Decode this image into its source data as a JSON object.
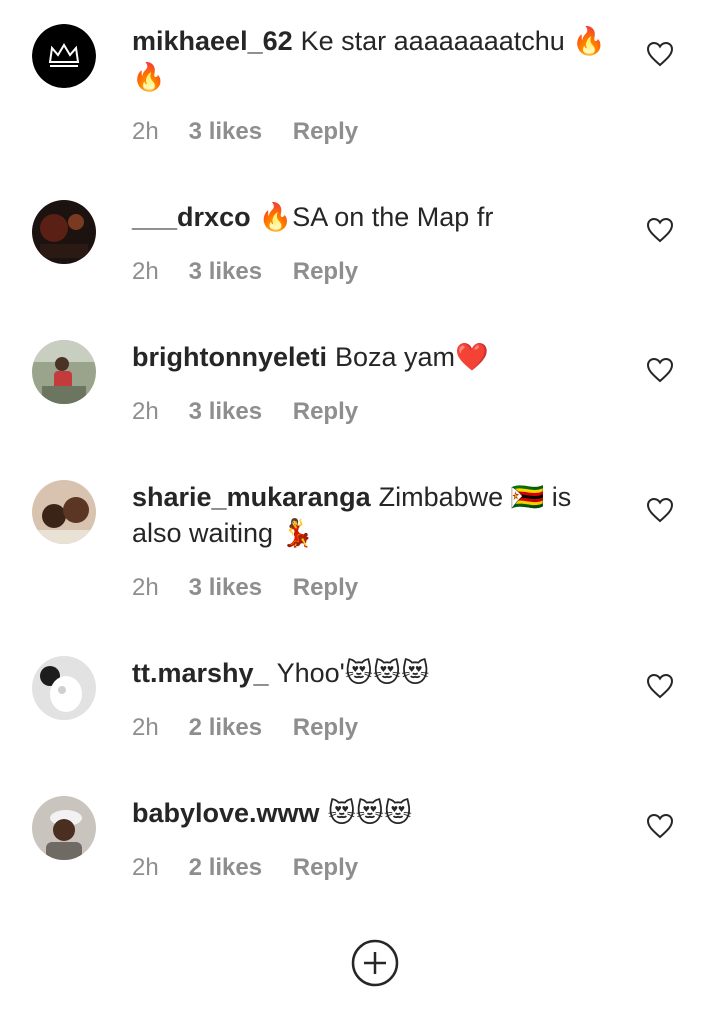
{
  "comments": [
    {
      "username": "mikhaeel_62",
      "text": "Ke star aaaaaaaatchu 🔥🔥",
      "time": "2h",
      "likes": "3 likes",
      "reply": "Reply",
      "avatar": "crown-logo"
    },
    {
      "username": "___drxco",
      "text": "🔥SA on the Map fr",
      "time": "2h",
      "likes": "3 likes",
      "reply": "Reply",
      "avatar": "dark-photo"
    },
    {
      "username": "brightonnyeleti",
      "text": "Boza yam❤️",
      "time": "2h",
      "likes": "3 likes",
      "reply": "Reply",
      "avatar": "person-photo"
    },
    {
      "username": "sharie_mukaranga",
      "text": "Zimbabwe 🇿🇼 is also waiting 💃",
      "time": "2h",
      "likes": "3 likes",
      "reply": "Reply",
      "avatar": "selfie-photo"
    },
    {
      "username": "tt.marshy_",
      "text": "Yhoo'😻😻😻",
      "time": "2h",
      "likes": "2 likes",
      "reply": "Reply",
      "avatar": "white-photo"
    },
    {
      "username": "babylove.www",
      "text": "😻😻😻",
      "time": "2h",
      "likes": "2 likes",
      "reply": "Reply",
      "avatar": "cap-photo"
    }
  ],
  "icons": {
    "like": "heart-outline-icon",
    "add": "add-circle-icon"
  },
  "colors": {
    "text": "#262626",
    "meta": "#8e8e8e"
  }
}
